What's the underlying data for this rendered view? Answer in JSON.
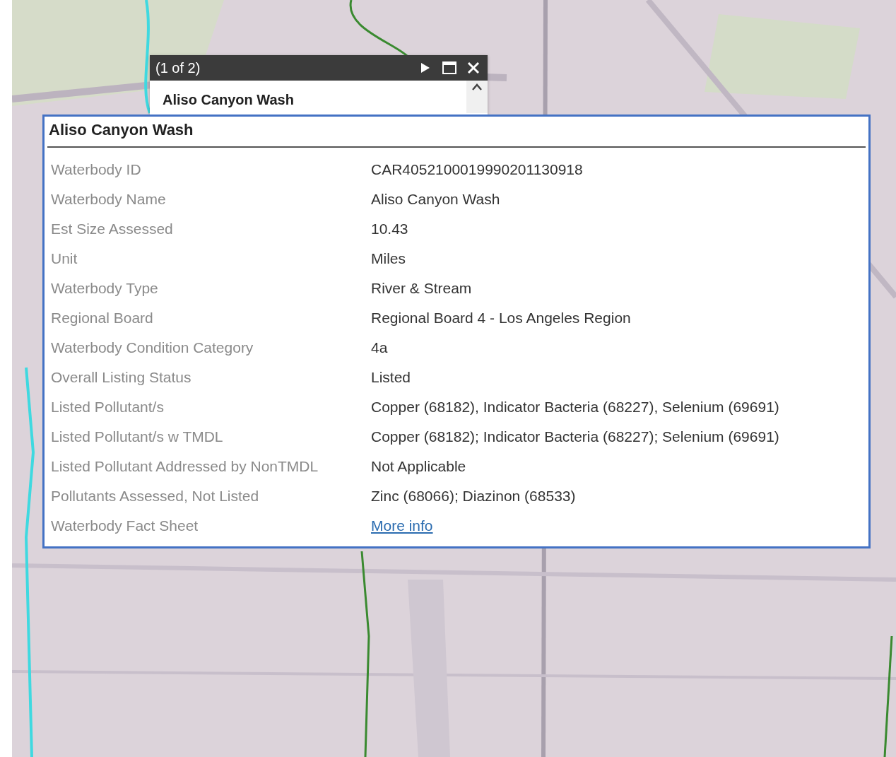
{
  "popup": {
    "counter": "(1 of 2)",
    "title": "Aliso Canyon Wash"
  },
  "panel": {
    "title": "Aliso Canyon Wash",
    "rows": [
      {
        "label": "Waterbody ID",
        "value": "CAR4052100019990201130918",
        "kind": "text"
      },
      {
        "label": "Waterbody Name",
        "value": "Aliso Canyon Wash",
        "kind": "text"
      },
      {
        "label": "Est Size Assessed",
        "value": "10.43",
        "kind": "text"
      },
      {
        "label": "Unit",
        "value": "Miles",
        "kind": "text"
      },
      {
        "label": "Waterbody Type",
        "value": "River & Stream",
        "kind": "text"
      },
      {
        "label": "Regional Board",
        "value": "Regional Board 4 - Los Angeles Region",
        "kind": "text"
      },
      {
        "label": "Waterbody Condition Category",
        "value": "4a",
        "kind": "text"
      },
      {
        "label": "Overall Listing Status",
        "value": "Listed",
        "kind": "text"
      },
      {
        "label": "Listed Pollutant/s",
        "value": "Copper (68182), Indicator Bacteria (68227), Selenium (69691)",
        "kind": "text"
      },
      {
        "label": "Listed Pollutant/s w TMDL",
        "value": "Copper (68182); Indicator Bacteria (68227); Selenium (69691)",
        "kind": "text"
      },
      {
        "label": "Listed Pollutant Addressed by NonTMDL",
        "value": "Not Applicable",
        "kind": "text"
      },
      {
        "label": "Pollutants Assessed, Not Listed",
        "value": "Zinc (68066); Diazinon (68533)",
        "kind": "text"
      },
      {
        "label": "Waterbody Fact Sheet",
        "value": "More info",
        "kind": "link"
      }
    ]
  }
}
